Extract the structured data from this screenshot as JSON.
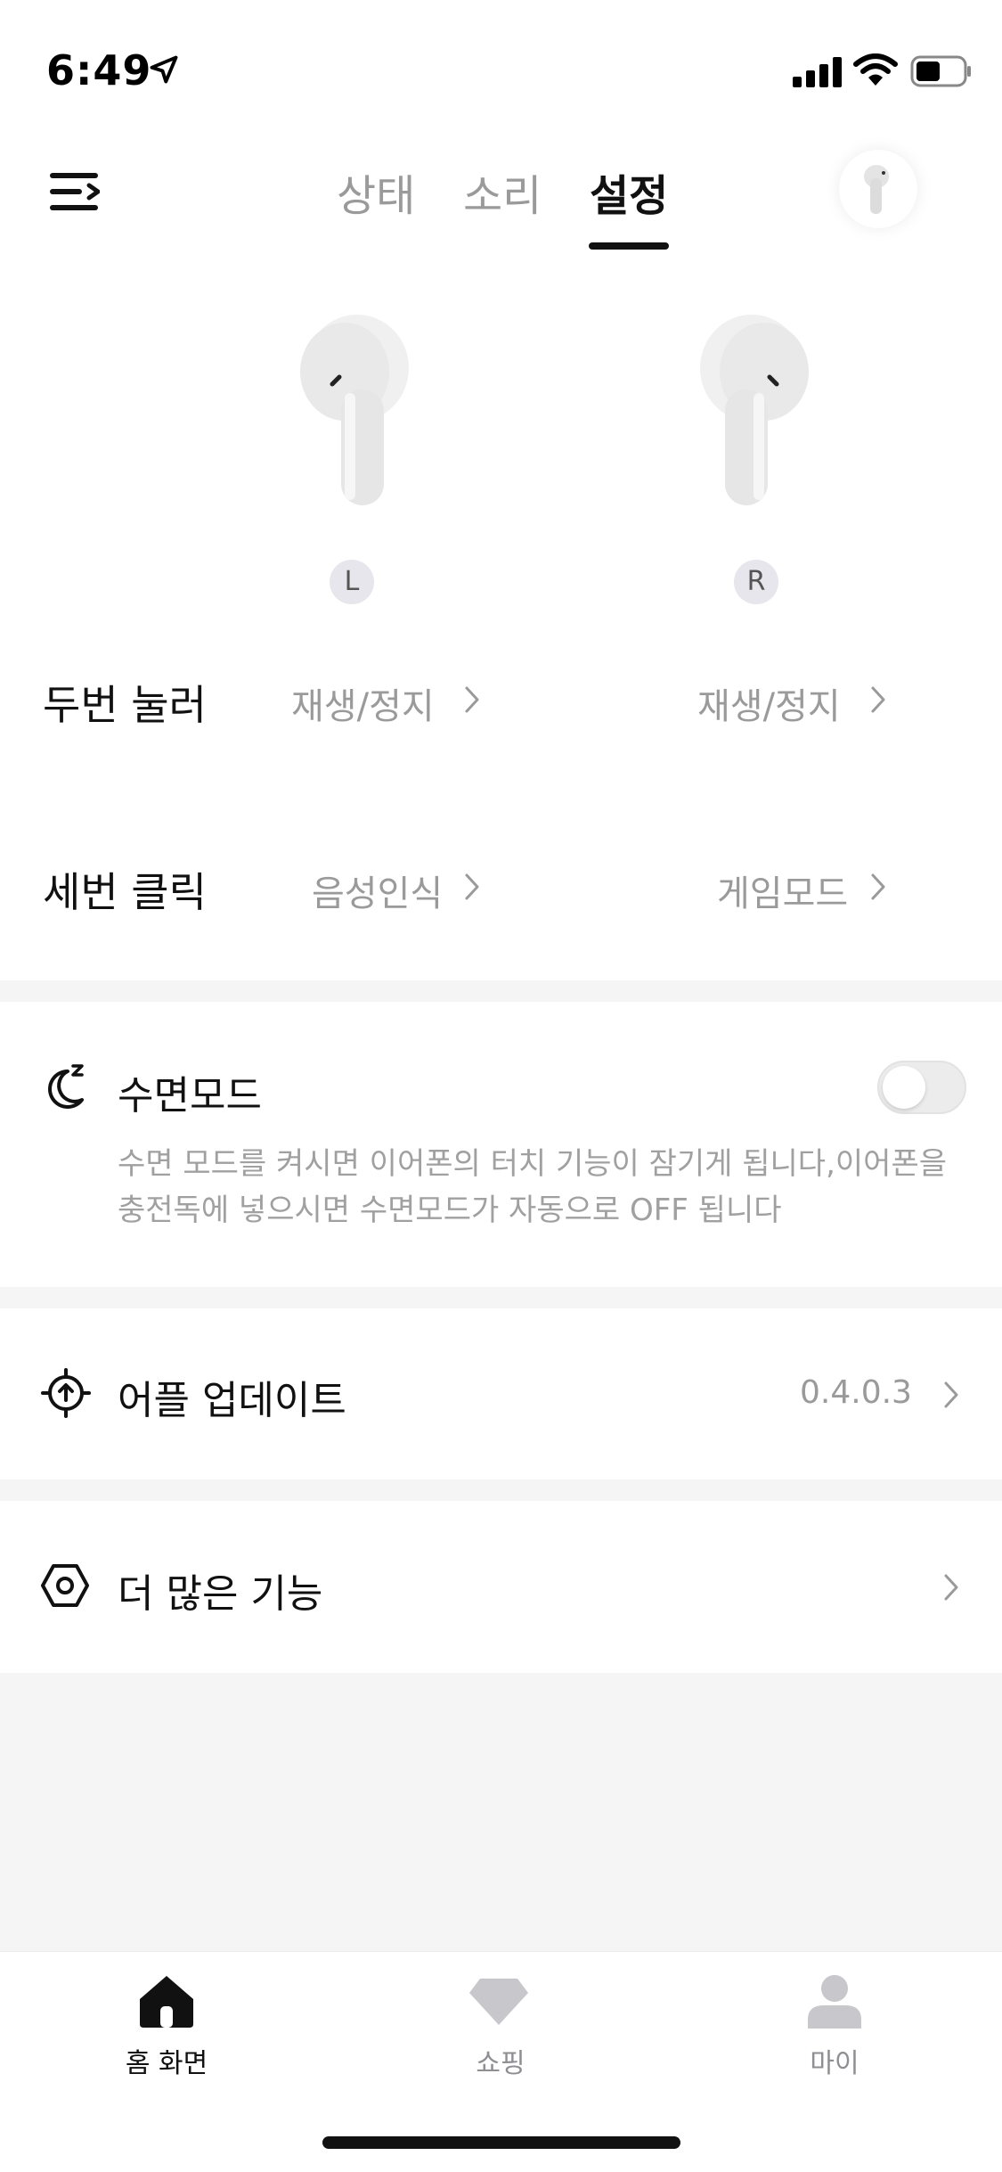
{
  "status_bar": {
    "time": "6:49"
  },
  "tabs": [
    {
      "label": "상태",
      "active": false
    },
    {
      "label": "소리",
      "active": false
    },
    {
      "label": "설정",
      "active": true
    }
  ],
  "earbuds": {
    "left_label": "L",
    "right_label": "R"
  },
  "gestures": {
    "double_tap": {
      "label": "두번 눌러",
      "left_value": "재생/정지",
      "right_value": "재생/정지"
    },
    "triple_tap": {
      "label": "세번 클릭",
      "left_value": "음성인식",
      "right_value": "게임모드"
    }
  },
  "sleep_mode": {
    "title": "수면모드",
    "enabled": false,
    "description": "수면 모드를 켜시면 이어폰의 터치 기능이 잠기게 됩니다,이어폰을 충전독에 넣으시면 수면모드가 자동으로 OFF 됩니다"
  },
  "app_update": {
    "title": "어플 업데이트",
    "version": "0.4.0.3"
  },
  "more_features": {
    "title": "더 많은 기능"
  },
  "bottom_nav": [
    {
      "label": "홈 화면",
      "active": true
    },
    {
      "label": "쇼핑",
      "active": false
    },
    {
      "label": "마이",
      "active": false
    }
  ],
  "colors": {
    "active_text": "#111111",
    "inactive_text": "#9a9a9a",
    "divider_bg": "#f5f5f5",
    "nav_inactive_icon": "#c7c7cc"
  }
}
